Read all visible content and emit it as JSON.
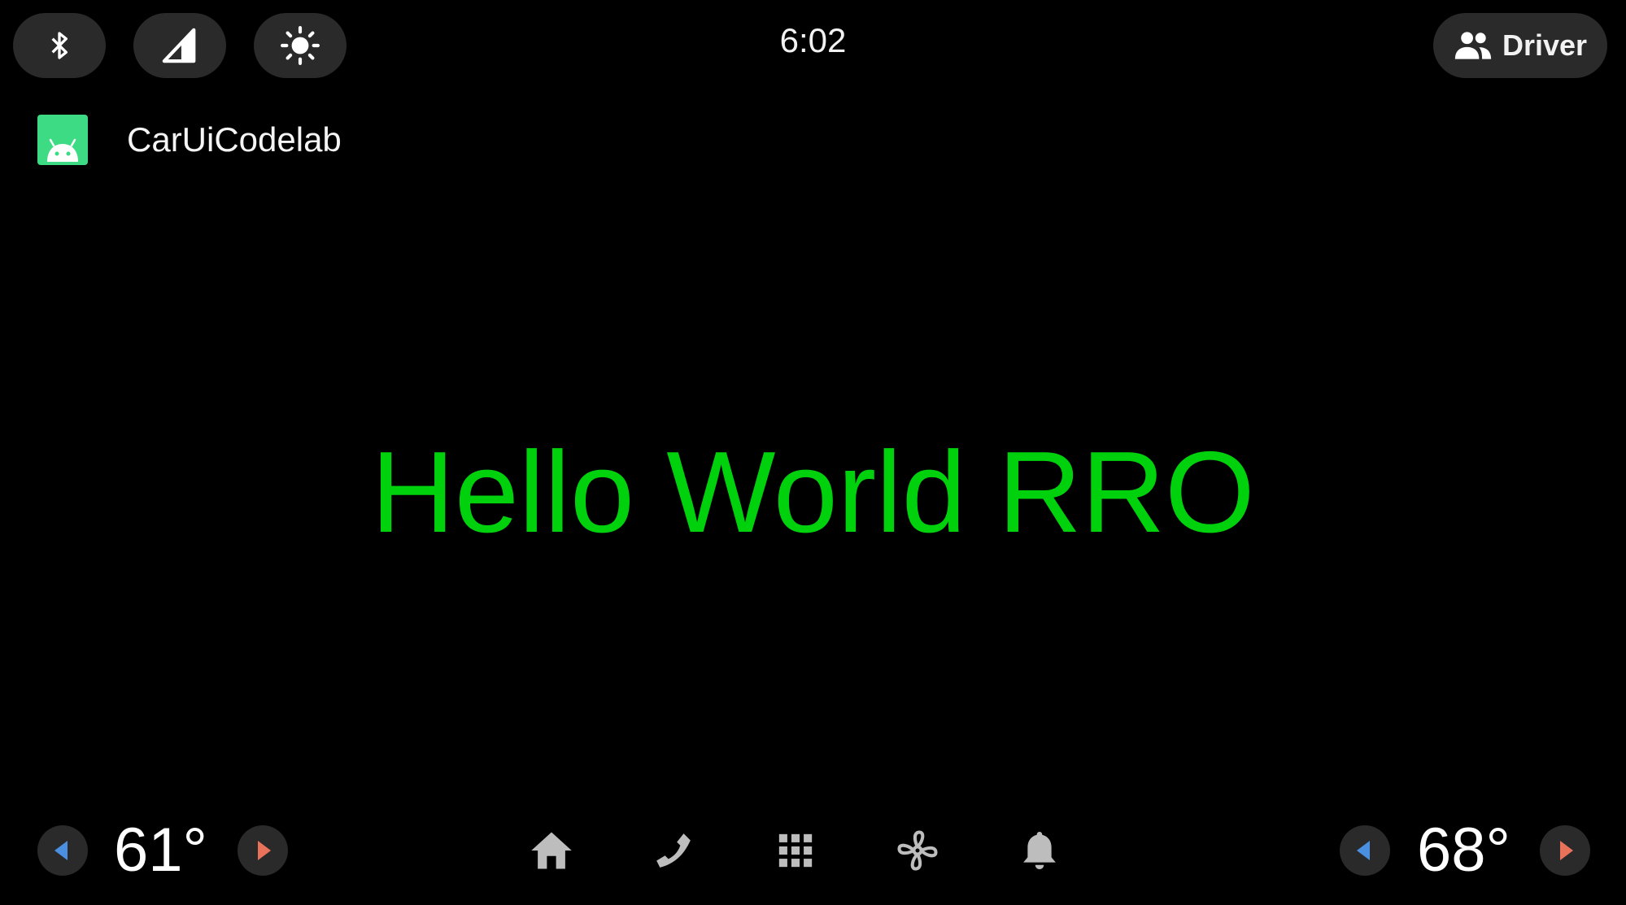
{
  "status_bar": {
    "icons": [
      "bluetooth-icon",
      "signal-icon",
      "brightness-icon"
    ],
    "clock": "6:02",
    "user_label": "Driver",
    "user_icon": "people-icon"
  },
  "app_bar": {
    "icon": "android-icon",
    "title": "CarUiCodelab"
  },
  "content": {
    "message": "Hello World RRO",
    "message_color": "#00d10d"
  },
  "nav_bar": {
    "left_temp": "61°",
    "right_temp": "68°",
    "icons": [
      "home-icon",
      "phone-icon",
      "apps-grid-icon",
      "fan-icon",
      "notification-bell-icon"
    ],
    "colors": {
      "decrease_arrow": "#4a8fe0",
      "increase_arrow": "#e8735a"
    }
  }
}
